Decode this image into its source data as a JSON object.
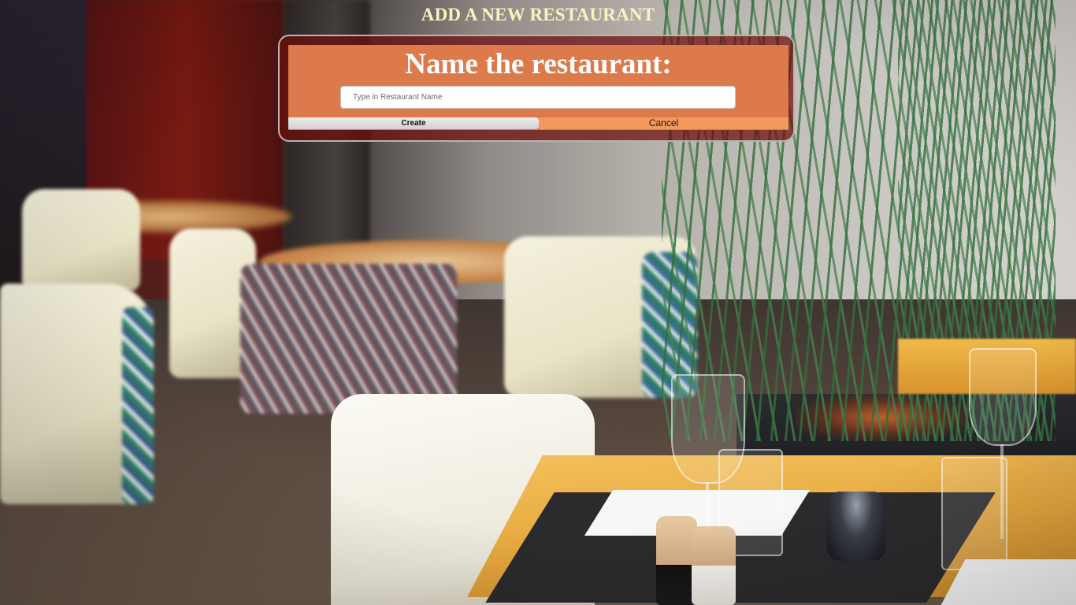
{
  "page": {
    "title": "ADD A NEW RESTAURANT"
  },
  "dialog": {
    "heading": "Name the restaurant:",
    "name_input": {
      "value": "",
      "placeholder": "Type in Restaurant Name"
    },
    "create_label": "Create",
    "cancel_label": "Cancel"
  },
  "colors": {
    "title_text": "#fbf3bf",
    "dialog_panel": "#dd7a4c",
    "dialog_frame": "#6e0c08",
    "create_button": "#dcdcdc",
    "cancel_button": "#f2985b"
  },
  "background": {
    "scene": "restaurant-interior-photo"
  }
}
